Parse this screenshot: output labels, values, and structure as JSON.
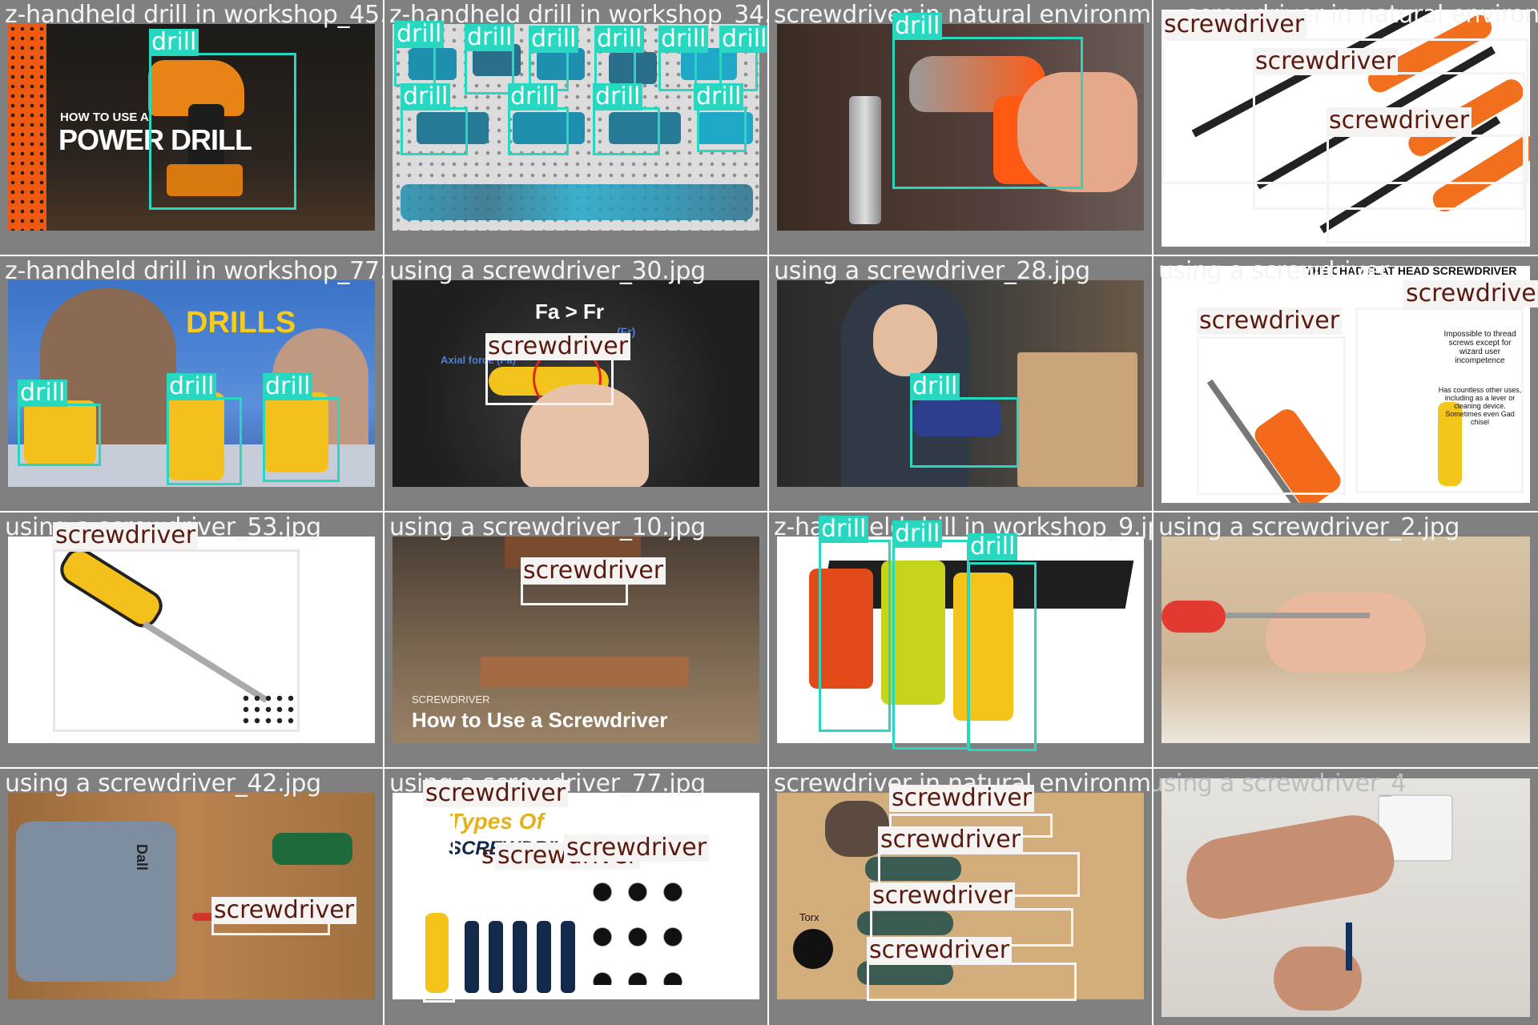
{
  "grid": {
    "columns": 4,
    "rows": 4
  },
  "cells": [
    {
      "filename": "z-handheld drill in workshop_45.jpg",
      "photo_text": [
        "HOW TO USE A",
        "POWER DRILL"
      ],
      "labels": [
        "drill"
      ]
    },
    {
      "filename": "z-handheld drill in workshop_34.jpg",
      "labels": [
        "drill",
        "drill",
        "drill",
        "drill",
        "drill",
        "drill",
        "drill",
        "drill",
        "drill",
        "drill"
      ]
    },
    {
      "filename": "screwdriver in natural environment",
      "labels": [
        "drill"
      ]
    },
    {
      "filename": "screwdriver in natural environment",
      "labels": [
        "screwdriver",
        "screwdriver",
        "screwdriver"
      ]
    },
    {
      "filename": "z-handheld drill in workshop_77.jpg",
      "photo_text": [
        "DRILLS"
      ],
      "labels": [
        "drill",
        "drill",
        "drill"
      ]
    },
    {
      "filename": "using a screwdriver_30.jpg",
      "photo_text": [
        "Fa > Fr",
        "Axial force (Fa)",
        "(Fr)"
      ],
      "labels": [
        "screwdriver"
      ]
    },
    {
      "filename": "using a screwdriver_28.jpg",
      "labels": [
        "drill"
      ]
    },
    {
      "filename": "using a screwdriver",
      "photo_text": [
        "THE CHAD FLAT HEAD SCREWDRIVER",
        "Impossible to thread screws except for wizard user incompetence",
        "Has countless other uses, including as a lever or cleaning device. Sometimes even Gad chisel"
      ],
      "labels": [
        "screwdriver",
        "screwdriver"
      ]
    },
    {
      "filename": "using a screwdriver_53.jpg",
      "labels": [
        "screwdriver"
      ]
    },
    {
      "filename": "using a screwdriver_10.jpg",
      "photo_text": [
        "SCREWDRIVER",
        "How to Use a Screwdriver"
      ],
      "labels": [
        "screwdriver"
      ]
    },
    {
      "filename": "z-handheld drill in workshop_9.jpg",
      "labels": [
        "drill",
        "drill",
        "drill"
      ]
    },
    {
      "filename": "using a screwdriver_2.jpg",
      "labels": []
    },
    {
      "filename": "using a screwdriver_42.jpg",
      "photo_text": [
        "Dall"
      ],
      "labels": [
        "screwdriver"
      ]
    },
    {
      "filename": "using a screwdriver_77.jpg",
      "photo_text": [
        "Types Of",
        "SCREWDRIVER"
      ],
      "labels": [
        "screwdriver",
        "screwdriver",
        "screwdriver",
        "screwdriver"
      ]
    },
    {
      "filename": "screwdriver in natural environment_9.jpg",
      "photo_text": [
        "Torx"
      ],
      "labels": [
        "screwdriver",
        "screwdriver",
        "screwdriver",
        "screwdriver"
      ]
    },
    {
      "filename": "using a screwdriver_4",
      "labels": []
    }
  ],
  "colors": {
    "drill": "#28d7bf",
    "screwdriver": "#f4f4f4",
    "cell_bg": "#808080"
  }
}
